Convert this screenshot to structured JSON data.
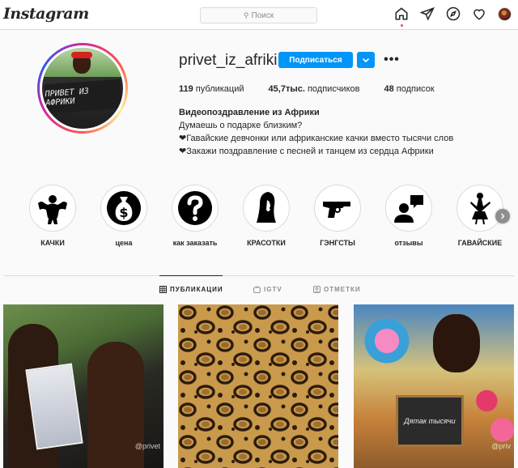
{
  "nav": {
    "logo": "Instagram",
    "search_placeholder": "Поиск",
    "icons": [
      "home-icon",
      "direct-icon",
      "explore-icon",
      "heart-icon",
      "profile-avatar"
    ]
  },
  "profile": {
    "username": "privet_iz_afriki",
    "avatar_sign_text": "ПРИВЕТ ИЗ АФРИКИ",
    "follow_label": "Подписаться",
    "more_label": "•••",
    "stats": {
      "posts_count": "119",
      "posts_label": " публикаций",
      "followers_count": "45,7тыс.",
      "followers_label": " подписчиков",
      "following_count": "48",
      "following_label": " подписок"
    },
    "bio": {
      "name": "Видеопоздравление из Африки",
      "line1": "Думаешь о подарке близким?",
      "line2": "Гавайские девчонки или африканские качки вместо тысячи слов",
      "line3": "Закажи поздравление с песней и танцем из сердца Африки"
    }
  },
  "highlights": [
    {
      "label": "КАЧКИ",
      "icon": "bodybuilder-icon"
    },
    {
      "label": "цена",
      "icon": "money-bag-icon"
    },
    {
      "label": "как заказать",
      "icon": "question-icon"
    },
    {
      "label": "КРАСОТКИ",
      "icon": "woman-silhouette-icon"
    },
    {
      "label": "ГЭНГСТЫ",
      "icon": "gun-icon"
    },
    {
      "label": "отзывы",
      "icon": "chat-person-icon"
    },
    {
      "label": "ГАВАЙСКИЕ",
      "icon": "hula-dancer-icon"
    }
  ],
  "tabs": [
    {
      "label": "ПУБЛИКАЦИИ",
      "icon": "grid-icon",
      "active": true
    },
    {
      "label": "IGTV",
      "icon": "igtv-icon",
      "active": false
    },
    {
      "label": "ОТМЕТКИ",
      "icon": "tag-icon",
      "active": false
    }
  ],
  "posts": [
    {
      "watermark": "@privet"
    },
    {
      "watermark": ""
    },
    {
      "watermark": "@priv",
      "board_text": "Дятак тысячи"
    }
  ],
  "colors": {
    "accent": "#0095f6",
    "notification_dot": "#ed4956"
  }
}
